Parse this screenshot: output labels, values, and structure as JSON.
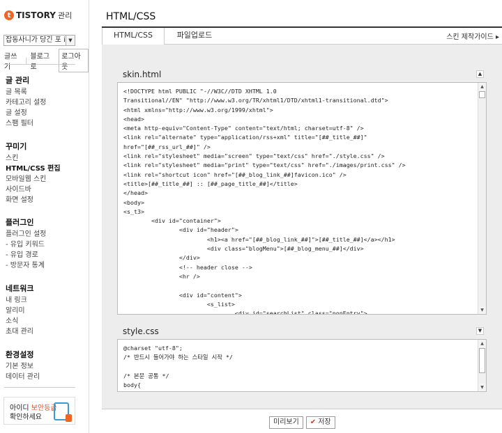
{
  "sidebar": {
    "logo_text": "TISTORY",
    "logo_sub": "관리",
    "blog_select": "잡동사니가 당긴 포 it...",
    "top_links": [
      "글쓰기",
      "블로그로"
    ],
    "logout_label": "로그아웃",
    "groups": [
      {
        "title": "글 관리",
        "items": [
          "글 목록",
          "카테고리 설정",
          "글 설정",
          "스팸 필터"
        ]
      },
      {
        "title": "꾸미기",
        "items": [
          "스킨",
          "HTML/CSS 편집",
          "모바일웹 스킨",
          "사이드바",
          "화면 설정"
        ],
        "active_index": 1
      },
      {
        "title": "플러그인",
        "items": [
          "플러그인 설정",
          "- 유입 키워드",
          "- 유입 경로",
          "- 방문자 통계"
        ]
      },
      {
        "title": "네트워크",
        "items": [
          "내 링크",
          "알리미",
          "소식",
          "초대 관리"
        ]
      },
      {
        "title": "환경설정",
        "items": [
          "기본 정보",
          "데이터 관리"
        ]
      }
    ],
    "banner": {
      "line1_prefix": "아이디 ",
      "line1_highlight": "보안등급",
      "line2": "확인하세요"
    }
  },
  "main": {
    "title": "HTML/CSS",
    "tabs": [
      "HTML/CSS",
      "파일업로드"
    ],
    "guide_link": "스킨 제작가이드 ▸",
    "editors": [
      {
        "label": "skin.html",
        "toggle": "▲",
        "lines": [
          "<!DOCTYPE html PUBLIC \"-//W3C//DTD XHTML 1.0",
          "Transitional//EN\" \"http://www.w3.org/TR/xhtml1/DTD/xhtml1-transitional.dtd\">",
          "<html xmlns=\"http://www.w3.org/1999/xhtml\">",
          "<head>",
          "<meta http-equiv=\"Content-Type\" content=\"text/html; charset=utf-8\" />",
          "<link rel=\"alternate\" type=\"application/rss+xml\" title=\"[##_title_##]\"",
          "href=\"[##_rss_url_##]\" />",
          "<link rel=\"stylesheet\" media=\"screen\" type=\"text/css\" href=\"./style.css\" />",
          "<link rel=\"stylesheet\" media=\"print\" type=\"text/css\" href=\"./images/print.css\" />",
          "<link rel=\"shortcut icon\" href=\"[##_blog_link_##]favicon.ico\" />",
          "<title>[##_title_##] :: [##_page_title_##]</title>",
          "</head>",
          "<body>",
          "<s_t3>",
          "        <div id=\"container\">",
          "                <div id=\"header\">",
          "                        <h1><a href=\"[##_blog_link_##]\">[##_title_##]</a></h1>",
          "                        <div class=\"blogMenu\">[##_blog_menu_##]</div>",
          "                </div>",
          "                <!-- header close -->",
          "                <hr />",
          "",
          "                <div id=\"content\">",
          "                        <s_list>",
          "                                <div id=\"searchList\" class=\"nonEntry\">"
        ]
      },
      {
        "label": "style.css",
        "toggle": "▼",
        "lines": [
          "@charset \"utf-8\";",
          "/* 반드시 들어가야 하는 스타일 시작 */",
          "",
          "/* 본문 공통 */",
          "body{"
        ]
      }
    ],
    "buttons": {
      "preview": "미리보기",
      "save": "저장"
    }
  }
}
